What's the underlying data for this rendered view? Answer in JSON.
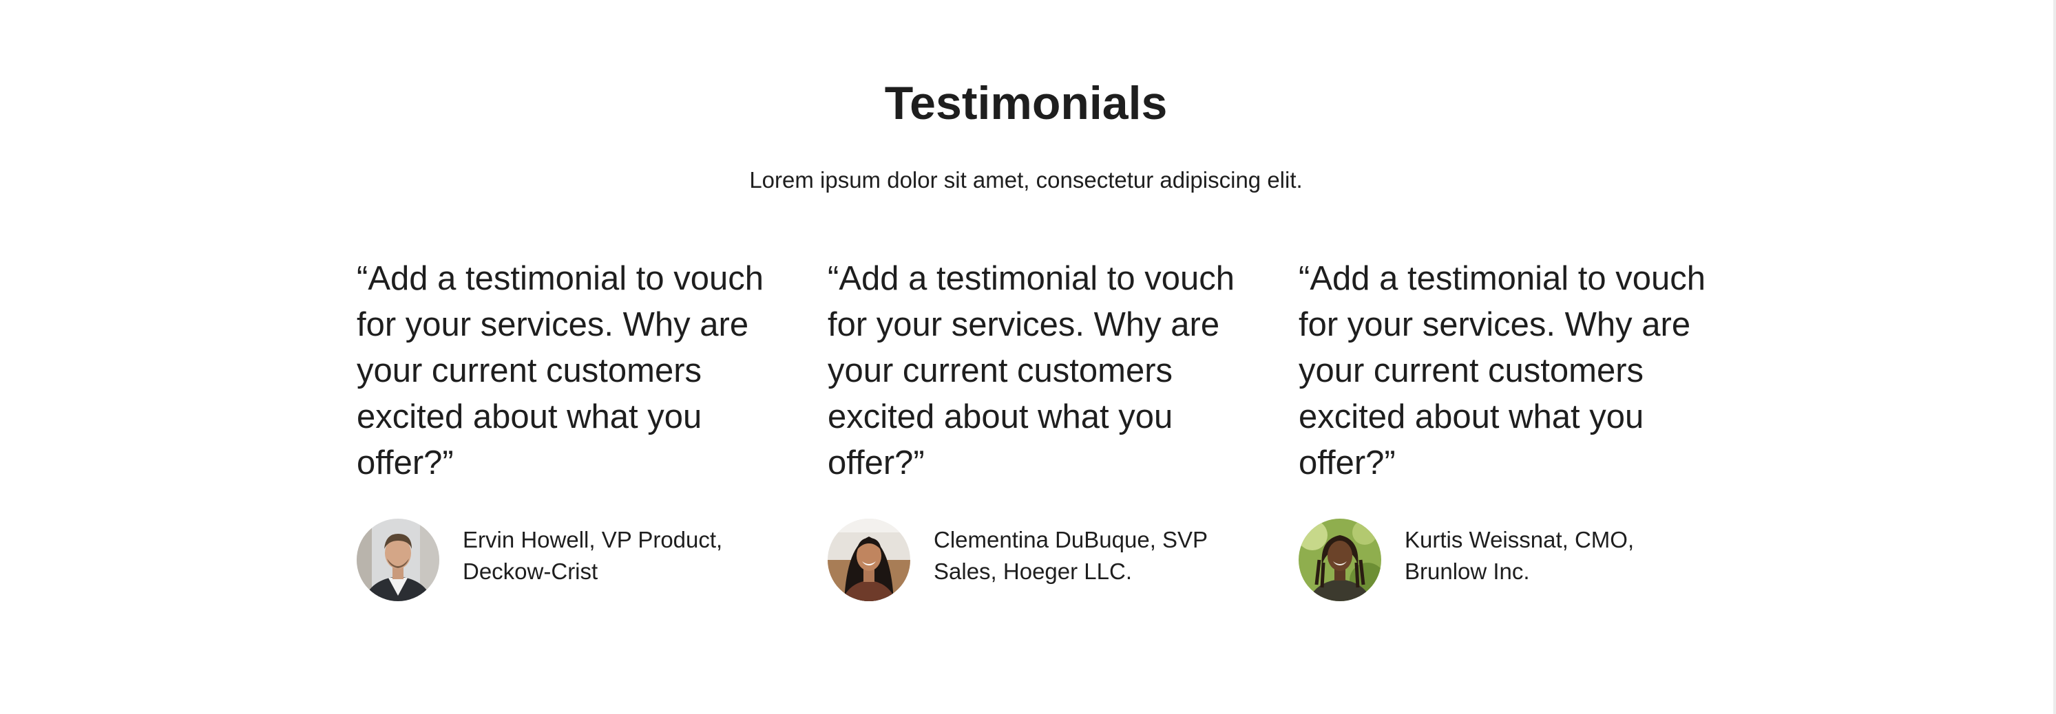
{
  "section": {
    "title": "Testimonials",
    "subtitle": "Lorem ipsum dolor sit amet, consectetur adipiscing elit."
  },
  "testimonials": [
    {
      "quote": "“Add a testimonial to vouch for your services. Why are your current customers excited about what you offer?”",
      "author": "Ervin Howell, VP Product, Deckow-Crist",
      "avatar_icon": "man-portrait-avatar"
    },
    {
      "quote": "“Add a testimonial to vouch for your services. Why are your current customers excited about what you offer?”",
      "author": "Clementina DuBuque, SVP Sales, Hoeger LLC.",
      "avatar_icon": "woman-portrait-avatar"
    },
    {
      "quote": "“Add a testimonial to vouch for your services. Why are your current customers excited about what you offer?”",
      "author": "Kurtis Weissnat, CMO, Brunlow Inc.",
      "avatar_icon": "man-portrait-avatar"
    }
  ]
}
